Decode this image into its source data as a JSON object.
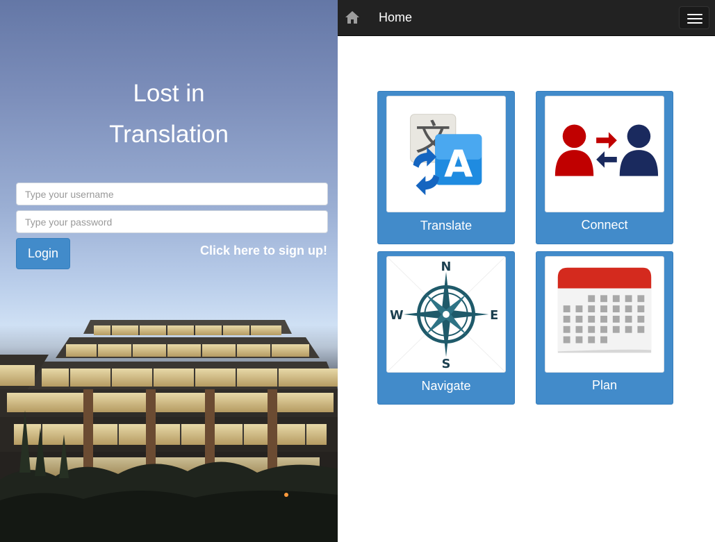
{
  "login": {
    "title_line1": "Lost in",
    "title_line2": "Translation",
    "username_placeholder": "Type your username",
    "password_placeholder": "Type your password",
    "login_button": "Login",
    "signup_link": "Click here to sign up!"
  },
  "navbar": {
    "brand": "Home",
    "home_icon": "home-icon",
    "menu_icon": "hamburger-menu-icon"
  },
  "tiles": [
    {
      "label": "Translate",
      "icon": "translate-icon"
    },
    {
      "label": "Connect",
      "icon": "connect-people-icon"
    },
    {
      "label": "Navigate",
      "icon": "compass-icon"
    },
    {
      "label": "Plan",
      "icon": "calendar-icon"
    }
  ],
  "compass": {
    "n": "N",
    "s": "S",
    "e": "E",
    "w": "W"
  },
  "colors": {
    "accent": "#428bca",
    "navbar": "#222222"
  }
}
